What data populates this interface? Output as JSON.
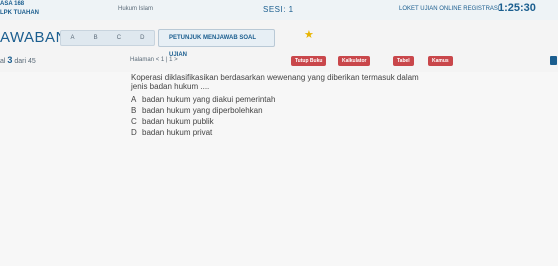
{
  "header": {
    "left_line1": "ASA 168",
    "left_line2": "LPK TUAHAN",
    "subject": "Hukum Islam",
    "session": "SESI: 1",
    "exam_title": "LOKET UJIAN ONLINE REGISTRASI",
    "timer": "1:25:30"
  },
  "answer_bar": {
    "title": "AWABAN",
    "options": [
      "A",
      "B",
      "C",
      "D"
    ],
    "instructions_label": "PETUNJUK MENJAWAB SOAL UJIAN"
  },
  "question_header": {
    "number_prefix": "al",
    "number": "3",
    "of_label": "dari 45",
    "page_label": "Halaman",
    "page_nav": "< 1 | 1 >",
    "buttons": [
      "Tutup Buku",
      "Kalkulator",
      "Tabel",
      "Kamus"
    ]
  },
  "question": {
    "text": "Koperasi diklasifikasikan berdasarkan wewenang yang diberikan termasuk dalam jenis badan hukum ....",
    "choices": [
      {
        "key": "A",
        "text": "badan hukum yang diakui pemerintah"
      },
      {
        "key": "B",
        "text": "badan hukum yang diperbolehkan"
      },
      {
        "key": "C",
        "text": "badan hukum publik"
      },
      {
        "key": "D",
        "text": "badan hukum privat"
      }
    ]
  }
}
